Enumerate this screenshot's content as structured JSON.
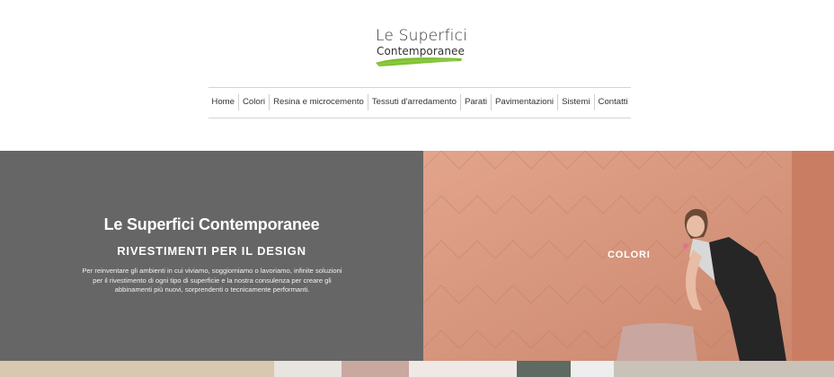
{
  "header": {
    "logo": {
      "line1": "Le Superfici",
      "line2": "Contemporanee",
      "brush_color": "#7fbf35"
    },
    "nav": [
      {
        "label": "Home"
      },
      {
        "label": "Colori"
      },
      {
        "label": "Resina e microcemento"
      },
      {
        "label": "Tessuti d'arredamento"
      },
      {
        "label": "Parati"
      },
      {
        "label": "Pavimentazioni"
      },
      {
        "label": "Sistemi"
      },
      {
        "label": "Contatti"
      }
    ]
  },
  "hero": {
    "title": "Le Superfici Contemporanee",
    "subtitle": "RIVESTIMENTI PER IL DESIGN",
    "description": "Per reinventare gli ambienti in cui viviamo, soggiorniamo o lavoriamo, infinite soluzioni per il rivestimento di ogni tipo di superficie e la nostra consulenza per creare gli abbinamenti più nuovi, sorprendenti o tecnicamente performanti.",
    "panel_color": "#666666",
    "image_label": "COLORI",
    "image_color": "#d4947b"
  },
  "strip": {
    "tile_colors": [
      "#d8c8b0",
      "#e8e4e0",
      "#c9a8a0",
      "#efe9e6",
      "#5e6a62",
      "#eeeeee",
      "#c8c2b8"
    ]
  }
}
